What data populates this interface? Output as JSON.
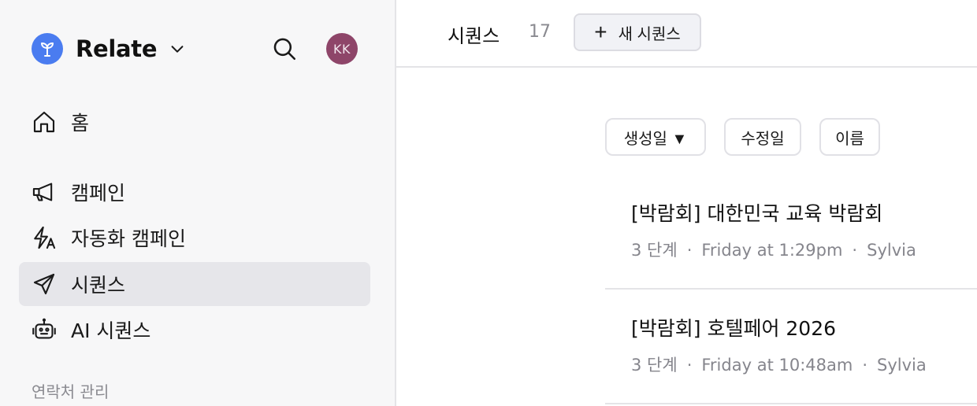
{
  "sidebar": {
    "brand_name": "Relate",
    "avatar_initials": "KK",
    "nav": {
      "home": "홈",
      "campaign": "캠페인",
      "auto_campaign": "자동화 캠페인",
      "sequence": "시퀀스",
      "ai_sequence": "AI 시퀀스"
    },
    "section_contacts": "연락처 관리"
  },
  "main": {
    "tab_title": "시퀀스",
    "tab_count": "17",
    "new_button_label": "새 시퀀스",
    "new_button_plus": "+",
    "sort": {
      "created": "생성일 ▼",
      "modified": "수정일",
      "name": "이름"
    },
    "rows": [
      {
        "title": "[박람회] 대한민국 교육 박람회",
        "steps": "3 단계",
        "time": "Friday at 1:29pm",
        "owner": "Sylvia"
      },
      {
        "title": "[박람회] 호텔페어 2026",
        "steps": "3 단계",
        "time": "Friday at 10:48am",
        "owner": "Sylvia"
      }
    ],
    "meta_separator": "·"
  },
  "colors": {
    "brand_blue": "#4a7cf0",
    "avatar": "#8e4569",
    "active_nav": "#e6e6ea"
  },
  "icons": [
    "brand-logo-icon",
    "chevron-down-icon",
    "search-icon",
    "home-icon",
    "megaphone-icon",
    "lightning-a-icon",
    "paper-plane-icon",
    "robot-icon",
    "plus-icon"
  ]
}
